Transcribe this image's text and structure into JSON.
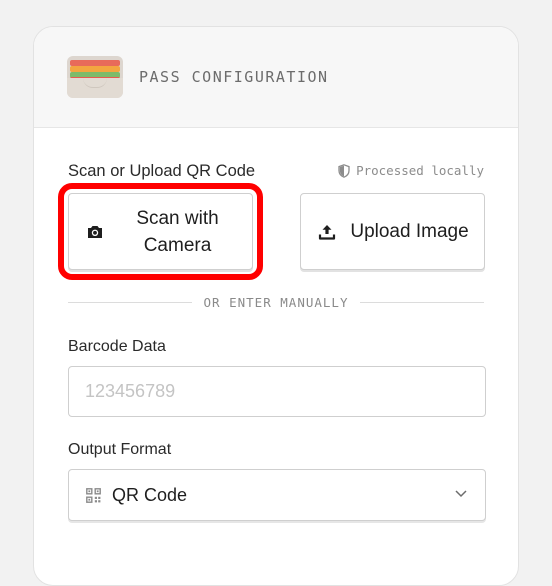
{
  "header": {
    "title": "PASS CONFIGURATION",
    "icon": "wallet-icon"
  },
  "scan_section": {
    "label": "Scan or Upload QR Code",
    "local_note": "Processed locally",
    "local_note_icon": "shield-icon",
    "scan_button": {
      "label": "Scan with Camera",
      "icon": "camera-icon"
    },
    "upload_button": {
      "label": "Upload Image",
      "icon": "upload-icon"
    }
  },
  "divider": {
    "text": "OR ENTER MANUALLY"
  },
  "barcode": {
    "label": "Barcode Data",
    "value": "",
    "placeholder": "123456789"
  },
  "output_format": {
    "label": "Output Format",
    "selected": "QR Code",
    "icon": "qr-code-icon"
  },
  "colors": {
    "highlight": "#ff0000",
    "wallet_stripes": [
      "#e86a5a",
      "#f3a540",
      "#7dbb6a",
      "#e85a4f"
    ]
  }
}
